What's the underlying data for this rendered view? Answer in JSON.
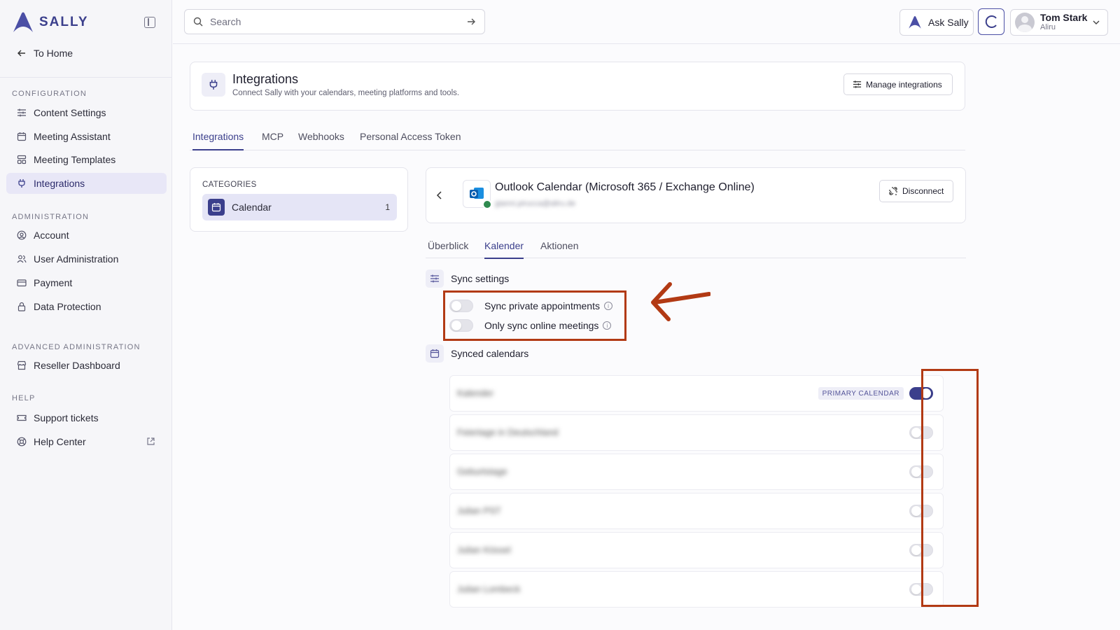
{
  "brand": {
    "name": "SALLY",
    "accent": "#3b3f8c",
    "highlight": "#b23a14"
  },
  "sidebar": {
    "to_home": "To Home",
    "sections": [
      {
        "title": "CONFIGURATION",
        "items": [
          "Content Settings",
          "Meeting Assistant",
          "Meeting Templates",
          "Integrations"
        ]
      },
      {
        "title": "ADMINISTRATION",
        "items": [
          "Account",
          "User Administration",
          "Payment",
          "Data Protection"
        ]
      },
      {
        "title": "ADVANCED ADMINISTRATION",
        "items": [
          "Reseller Dashboard"
        ]
      },
      {
        "title": "HELP",
        "items": [
          "Support tickets",
          "Help Center"
        ]
      }
    ],
    "active_item": "Integrations"
  },
  "topbar": {
    "search_placeholder": "Search",
    "ask_label": "Ask Sally",
    "user": {
      "name": "Tom Stark",
      "org": "Aliru"
    }
  },
  "header": {
    "title": "Integrations",
    "subtitle": "Connect Sally with your calendars, meeting platforms and tools.",
    "manage_label": "Manage integrations"
  },
  "tabs": [
    "Integrations",
    "MCP",
    "Webhooks",
    "Personal Access Token"
  ],
  "categories": {
    "label": "CATEGORIES",
    "items": [
      {
        "name": "Calendar",
        "count": "1"
      }
    ]
  },
  "detail": {
    "title": "Outlook Calendar (Microsoft 365 / Exchange Online)",
    "account": "gianni.pirucca@aliru.de",
    "disconnect_label": "Disconnect",
    "subtabs": [
      "Überblick",
      "Kalender",
      "Aktionen"
    ]
  },
  "sync_settings": {
    "title": "Sync settings",
    "options": [
      {
        "label": "Sync private appointments",
        "enabled": false
      },
      {
        "label": "Only sync online meetings",
        "enabled": false
      }
    ]
  },
  "synced_calendars": {
    "title": "Synced calendars",
    "primary_badge": "PRIMARY CALENDAR",
    "items": [
      {
        "name": "Kalender",
        "enabled": true,
        "primary": true
      },
      {
        "name": "Feiertage in Deutschland",
        "enabled": false
      },
      {
        "name": "Geburtstage",
        "enabled": false
      },
      {
        "name": "Julian PST",
        "enabled": false
      },
      {
        "name": "Julian Kössel",
        "enabled": false
      },
      {
        "name": "Julian Lombeck",
        "enabled": false
      }
    ]
  }
}
